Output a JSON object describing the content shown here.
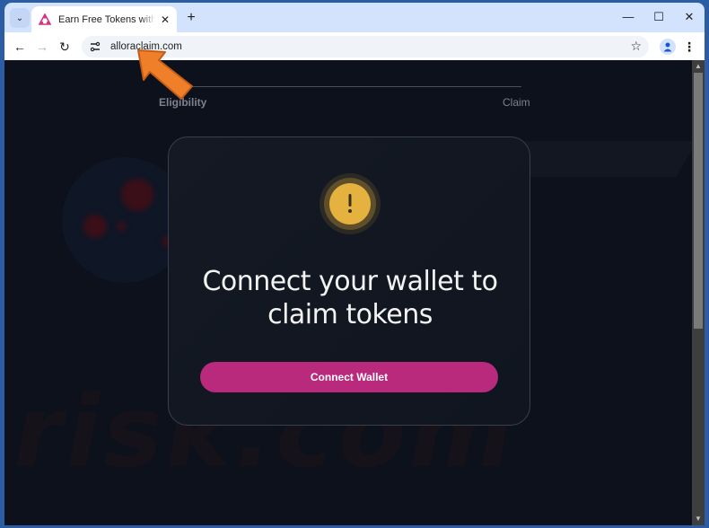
{
  "browser": {
    "tab": {
      "title": "Earn Free Tokens with the Allora",
      "favicon": "allora-triangle-icon",
      "favicon_color": "#d63384"
    },
    "tab_search_icon": "chevron-down-icon",
    "new_tab_label": "+",
    "window_controls": {
      "minimize": "—",
      "maximize": "☐",
      "close": "✕"
    },
    "nav": {
      "back": "←",
      "forward": "→",
      "reload": "↻"
    },
    "address": {
      "url": "alloraclaim.com"
    },
    "bookmark_icon": "☆",
    "menu_icon": "⋮"
  },
  "page": {
    "steps": {
      "left": "Eligibility",
      "right": "Claim"
    },
    "card": {
      "icon": "warning-icon",
      "icon_color": "#e6b23f",
      "title_line1": "Connect your wallet to",
      "title_line2": "claim tokens",
      "button_label": "Connect Wallet",
      "button_color": "#b92a7c"
    },
    "watermark": "risk.com"
  },
  "scrollbar": {
    "position_fraction": 0.0
  }
}
